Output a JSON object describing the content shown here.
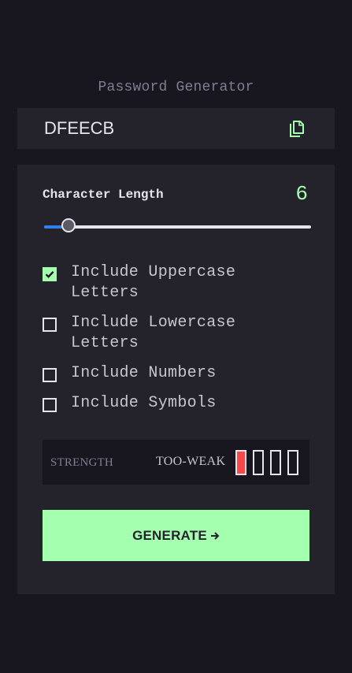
{
  "app": {
    "title": "Password Generator"
  },
  "password": {
    "value": "DFEECB",
    "copy_icon": "copy-icon"
  },
  "length": {
    "label": "Character Length",
    "value": "6",
    "min": 0,
    "max": 64
  },
  "options": [
    {
      "label": "Include Uppercase Letters",
      "checked": true
    },
    {
      "label": "Include Lowercase Letters",
      "checked": false
    },
    {
      "label": "Include Numbers",
      "checked": false
    },
    {
      "label": "Include Symbols",
      "checked": false
    }
  ],
  "strength": {
    "label": "STRENGTH",
    "rating": "TOO-WEAK",
    "level": 1,
    "total_bars": 4,
    "active_color": "#f64a4a"
  },
  "generate": {
    "label": "GENERATE",
    "icon": "arrow-right-icon"
  },
  "colors": {
    "background": "#18171f",
    "panel": "#24232c",
    "accent": "#a4ffaf",
    "slider_fill": "#2f80ed",
    "weak": "#f64a4a"
  }
}
